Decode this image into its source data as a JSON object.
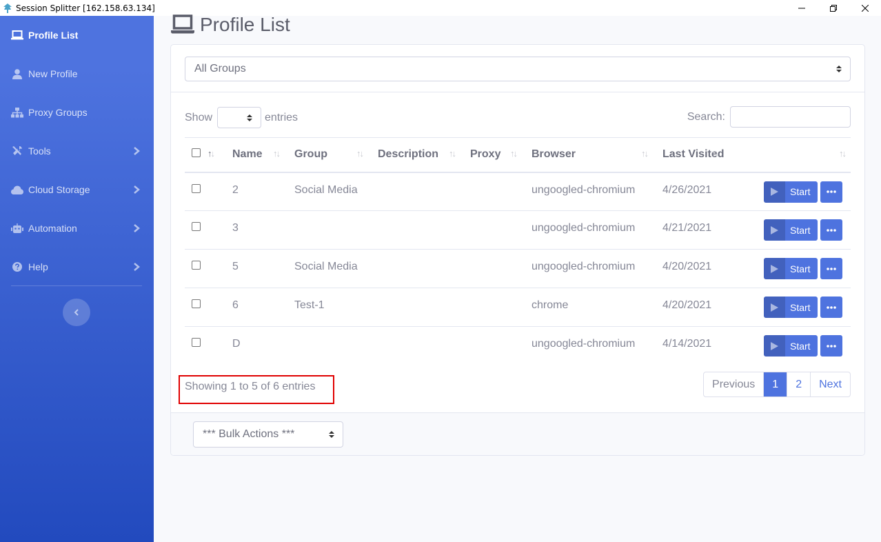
{
  "window": {
    "title": "Session Splitter [162.158.63.134]",
    "icon": "tree-icon",
    "controls": [
      "minimize-icon",
      "restore-icon",
      "close-icon"
    ]
  },
  "sidebar": {
    "items": [
      {
        "label": "Profile List",
        "icon": "laptop-icon",
        "active": true
      },
      {
        "label": "New Profile",
        "icon": "user-icon"
      },
      {
        "label": "Proxy Groups",
        "icon": "sitemap-icon"
      },
      {
        "label": "Tools",
        "icon": "tools-icon",
        "expandable": true
      },
      {
        "label": "Cloud Storage",
        "icon": "cloud-icon",
        "expandable": true
      },
      {
        "label": "Automation",
        "icon": "robot-icon",
        "expandable": true
      },
      {
        "label": "Help",
        "icon": "question-icon",
        "expandable": true
      }
    ],
    "toggle_icon": "chevron-left-icon"
  },
  "page": {
    "title": "Profile List",
    "title_icon": "laptop-icon"
  },
  "filters": {
    "group_select": "All Groups",
    "show_label": "Show",
    "entries_label": "entries",
    "page_length_value": "",
    "search_label": "Search:",
    "search_value": ""
  },
  "table": {
    "columns": [
      "Name",
      "Group",
      "Description",
      "Proxy",
      "Browser",
      "Last Visited"
    ],
    "rows": [
      {
        "name": "2",
        "group": "Social Media",
        "description": "",
        "proxy": "",
        "browser": "ungoogled-chromium",
        "last_visited": "4/26/2021"
      },
      {
        "name": "3",
        "group": "",
        "description": "",
        "proxy": "",
        "browser": "ungoogled-chromium",
        "last_visited": "4/21/2021"
      },
      {
        "name": "5",
        "group": "Social Media",
        "description": "",
        "proxy": "",
        "browser": "ungoogled-chromium",
        "last_visited": "4/20/2021"
      },
      {
        "name": "6",
        "group": "Test-1",
        "description": "",
        "proxy": "",
        "browser": "chrome",
        "last_visited": "4/20/2021"
      },
      {
        "name": "D",
        "group": "",
        "description": "",
        "proxy": "",
        "browser": "ungoogled-chromium",
        "last_visited": "4/14/2021"
      }
    ],
    "start_label": "Start"
  },
  "footer": {
    "info": "Showing 1 to 5 of 6 entries",
    "pagination": {
      "previous": "Previous",
      "pages": [
        "1",
        "2"
      ],
      "current": "1",
      "next": "Next"
    },
    "bulk_actions": "*** Bulk Actions ***"
  },
  "colors": {
    "primary": "#4e73df",
    "sidebar_gradient_end": "#224abe",
    "highlight": "#e00000"
  }
}
